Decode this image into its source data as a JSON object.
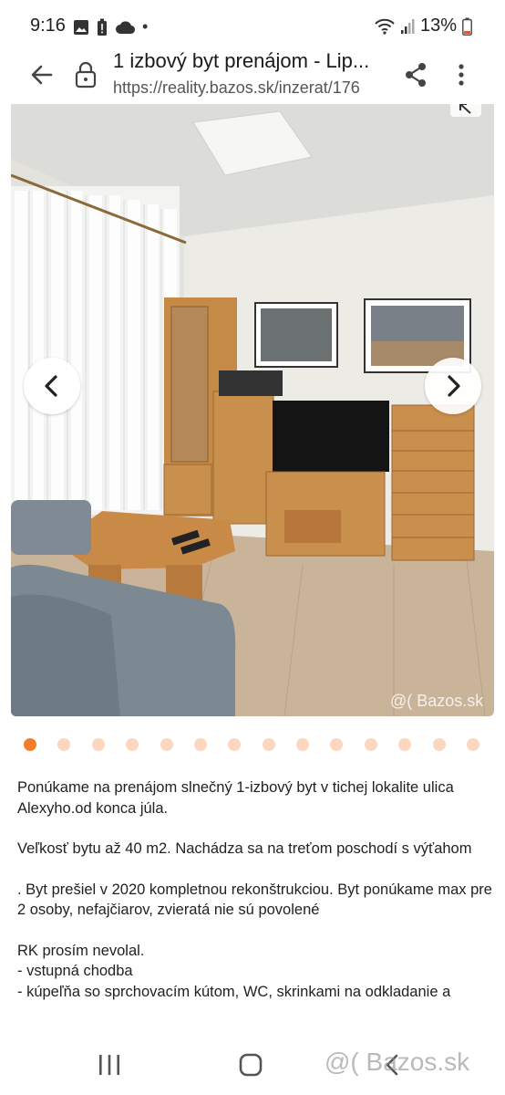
{
  "status": {
    "time": "9:16",
    "battery": "13%",
    "dot": "•"
  },
  "toolbar": {
    "title": "1 izbový byt prenájom - Lip...",
    "url": "https://reality.bazos.sk/inzerat/176"
  },
  "gallery": {
    "watermark": "@( Bazos.sk",
    "dot_count": 14,
    "active_index": 0
  },
  "description": {
    "paragraphs": [
      "Ponúkame na prenájom slnečný 1-izbový byt v tichej lokalite ulica Alexyho.od konca júla.",
      "Veľkosť bytu až 40 m2. Nachádza sa na treťom poschodí s výťahom",
      "",
      ". Byt prešiel v 2020 kompletnou rekonštrukciou. Byt ponúkame max pre 2 osoby, nefajčiarov, zvieratá nie sú povolené",
      "RK prosím nevolal.\n- vstupná chodba\n- kúpeľňa so sprchovacím kútom, WC, skrinkami na odkladanie a"
    ]
  },
  "bottom_watermark": "@( Bazos.sk",
  "colors": {
    "accent": "#f47d2b",
    "dot_inactive": "#fbd7c0"
  }
}
